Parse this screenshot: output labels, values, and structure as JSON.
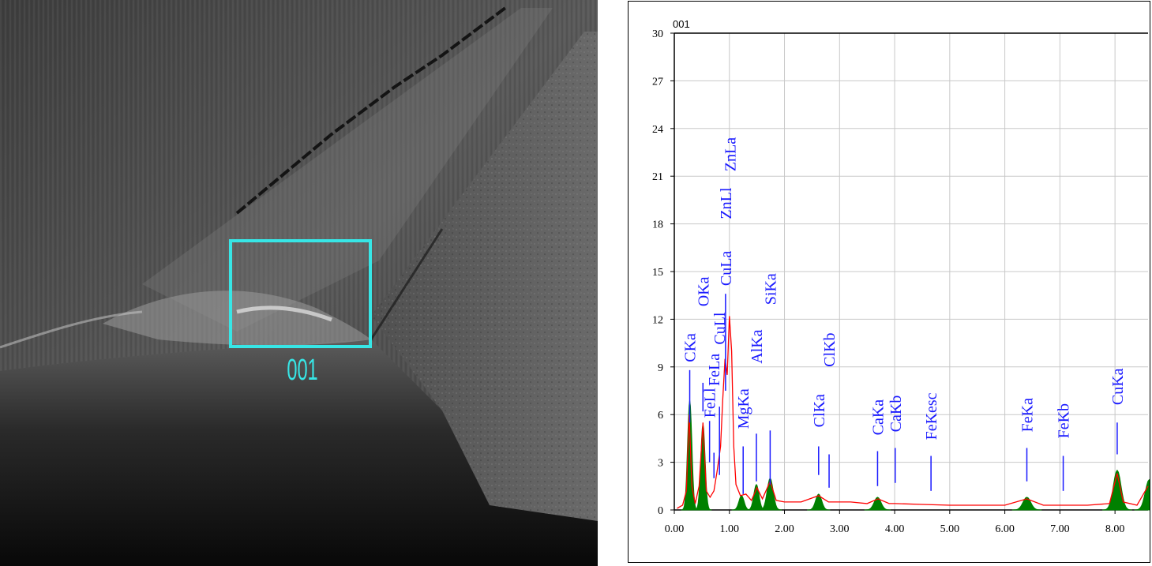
{
  "sem_image": {
    "roi_label": "001",
    "roi_color": "#37e6e6"
  },
  "chart_data": {
    "type": "line",
    "title": "001",
    "xlabel": "",
    "ylabel": "",
    "xlim": [
      0,
      8.6
    ],
    "ylim": [
      0,
      30
    ],
    "x_ticks": [
      "0.00",
      "1.00",
      "2.00",
      "3.00",
      "4.00",
      "5.00",
      "6.00",
      "7.00",
      "8.00"
    ],
    "y_ticks": [
      "0",
      "3",
      "6",
      "9",
      "12",
      "15",
      "18",
      "21",
      "24",
      "27",
      "30"
    ],
    "grid": true,
    "series": [
      {
        "color": "#ff0000",
        "points": [
          [
            0.05,
            0.1
          ],
          [
            0.15,
            0.3
          ],
          [
            0.22,
            1.2
          ],
          [
            0.27,
            6.0
          ],
          [
            0.32,
            1.5
          ],
          [
            0.38,
            0.4
          ],
          [
            0.45,
            1.5
          ],
          [
            0.52,
            5.5
          ],
          [
            0.58,
            1.2
          ],
          [
            0.65,
            0.8
          ],
          [
            0.72,
            1.2
          ],
          [
            0.78,
            2.5
          ],
          [
            0.84,
            4.0
          ],
          [
            0.88,
            7.0
          ],
          [
            0.92,
            9.5
          ],
          [
            0.96,
            8.5
          ],
          [
            1.0,
            12.2
          ],
          [
            1.04,
            10.0
          ],
          [
            1.08,
            4.0
          ],
          [
            1.12,
            1.6
          ],
          [
            1.2,
            0.9
          ],
          [
            1.3,
            1.0
          ],
          [
            1.4,
            0.6
          ],
          [
            1.5,
            1.4
          ],
          [
            1.6,
            0.7
          ],
          [
            1.74,
            1.8
          ],
          [
            1.85,
            0.6
          ],
          [
            2.0,
            0.5
          ],
          [
            2.3,
            0.5
          ],
          [
            2.62,
            0.9
          ],
          [
            2.8,
            0.5
          ],
          [
            3.2,
            0.5
          ],
          [
            3.5,
            0.4
          ],
          [
            3.7,
            0.7
          ],
          [
            3.9,
            0.4
          ],
          [
            4.0,
            0.4
          ],
          [
            4.5,
            0.35
          ],
          [
            5.0,
            0.3
          ],
          [
            5.5,
            0.3
          ],
          [
            6.0,
            0.3
          ],
          [
            6.4,
            0.7
          ],
          [
            6.7,
            0.3
          ],
          [
            7.0,
            0.3
          ],
          [
            7.5,
            0.3
          ],
          [
            7.9,
            0.4
          ],
          [
            8.04,
            2.3
          ],
          [
            8.15,
            0.5
          ],
          [
            8.4,
            0.3
          ],
          [
            8.6,
            1.5
          ]
        ]
      },
      {
        "color": "#008000",
        "filled": true,
        "peaks": [
          {
            "x": 0.28,
            "y": 6.9,
            "w": 0.05
          },
          {
            "x": 0.52,
            "y": 5.4,
            "w": 0.05
          },
          {
            "x": 1.22,
            "y": 0.9,
            "w": 0.06
          },
          {
            "x": 1.49,
            "y": 1.6,
            "w": 0.06
          },
          {
            "x": 1.74,
            "y": 2.0,
            "w": 0.07
          },
          {
            "x": 2.62,
            "y": 1.0,
            "w": 0.07
          },
          {
            "x": 3.69,
            "y": 0.8,
            "w": 0.08
          },
          {
            "x": 6.4,
            "y": 0.8,
            "w": 0.09
          },
          {
            "x": 8.04,
            "y": 2.5,
            "w": 0.09
          },
          {
            "x": 8.62,
            "y": 1.9,
            "w": 0.09
          }
        ]
      }
    ],
    "element_labels": [
      {
        "text": "CKa",
        "x": 0.28,
        "y": 9.3,
        "line_y1": 5.5,
        "line_y2": 8.8
      },
      {
        "text": "OKa",
        "x": 0.52,
        "y": 12.8,
        "line_y1": 6.2,
        "line_y2": 8.0
      },
      {
        "text": "FeLl",
        "x": 0.64,
        "y": 5.8,
        "line_y1": 3.0,
        "line_y2": 5.6
      },
      {
        "text": "FeLa",
        "x": 0.72,
        "y": 7.8,
        "line_y1": 2.0,
        "line_y2": 3.6
      },
      {
        "text": "CuLl",
        "x": 0.82,
        "y": 10.4,
        "line_y1": 2.2,
        "line_y2": 6.5
      },
      {
        "text": "CuLa",
        "x": 0.93,
        "y": 14.1,
        "line_y1": 7.5,
        "line_y2": 13.6
      },
      {
        "text": "ZnLl",
        "x": 0.93,
        "y": 18.3,
        "line_y1": 0,
        "line_y2": 0
      },
      {
        "text": "ZnLa",
        "x": 1.01,
        "y": 21.3,
        "line_y1": 0,
        "line_y2": 0
      },
      {
        "text": "MgKa",
        "x": 1.25,
        "y": 5.1,
        "line_y1": 1.0,
        "line_y2": 4.0
      },
      {
        "text": "AlKa",
        "x": 1.49,
        "y": 9.2,
        "line_y1": 1.8,
        "line_y2": 4.8
      },
      {
        "text": "SiKa",
        "x": 1.74,
        "y": 12.9,
        "line_y1": 1.6,
        "line_y2": 5.0
      },
      {
        "text": "ClKa",
        "x": 2.62,
        "y": 5.2,
        "line_y1": 2.2,
        "line_y2": 4.0
      },
      {
        "text": "ClKb",
        "x": 2.81,
        "y": 9.0,
        "line_y1": 1.4,
        "line_y2": 3.5
      },
      {
        "text": "CaKa",
        "x": 3.69,
        "y": 4.7,
        "line_y1": 1.5,
        "line_y2": 3.7
      },
      {
        "text": "CaKb",
        "x": 4.01,
        "y": 4.9,
        "line_y1": 1.7,
        "line_y2": 3.9
      },
      {
        "text": "FeKesc",
        "x": 4.66,
        "y": 4.4,
        "line_y1": 1.2,
        "line_y2": 3.4
      },
      {
        "text": "FeKa",
        "x": 6.4,
        "y": 4.9,
        "line_y1": 1.8,
        "line_y2": 3.9
      },
      {
        "text": "FeKb",
        "x": 7.06,
        "y": 4.5,
        "line_y1": 1.2,
        "line_y2": 3.4
      },
      {
        "text": "CuKa",
        "x": 8.04,
        "y": 6.6,
        "line_y1": 3.5,
        "line_y2": 5.5
      }
    ]
  }
}
